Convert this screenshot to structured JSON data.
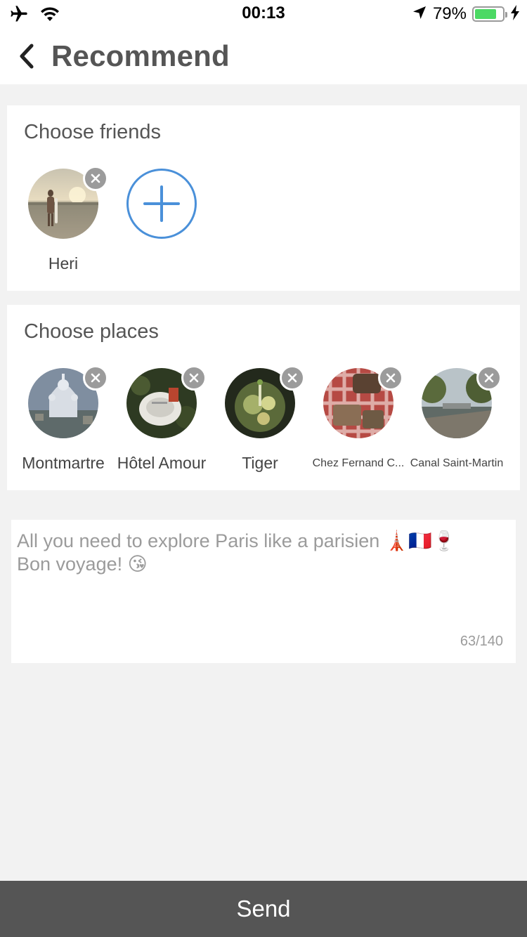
{
  "status_bar": {
    "time": "00:13",
    "battery_pct": "79%",
    "battery_level": 0.79
  },
  "nav": {
    "title": "Recommend"
  },
  "friends": {
    "title": "Choose friends",
    "items": [
      {
        "name": "Heri"
      }
    ]
  },
  "places": {
    "title": "Choose places",
    "items": [
      {
        "name": "Montmartre"
      },
      {
        "name": "Hôtel Amour"
      },
      {
        "name": "Tiger"
      },
      {
        "name": "Chez Fernand C..."
      },
      {
        "name": "Canal Saint-Martin"
      }
    ]
  },
  "message": {
    "text": "All you need to explore Paris like a parisien 🗼🇫🇷🍷\nBon voyage! 😘",
    "count": "63/140"
  },
  "send_label": "Send",
  "colors": {
    "accent_blue": "#4a90d9",
    "send_bg": "#555555",
    "battery_green": "#4cd964"
  }
}
